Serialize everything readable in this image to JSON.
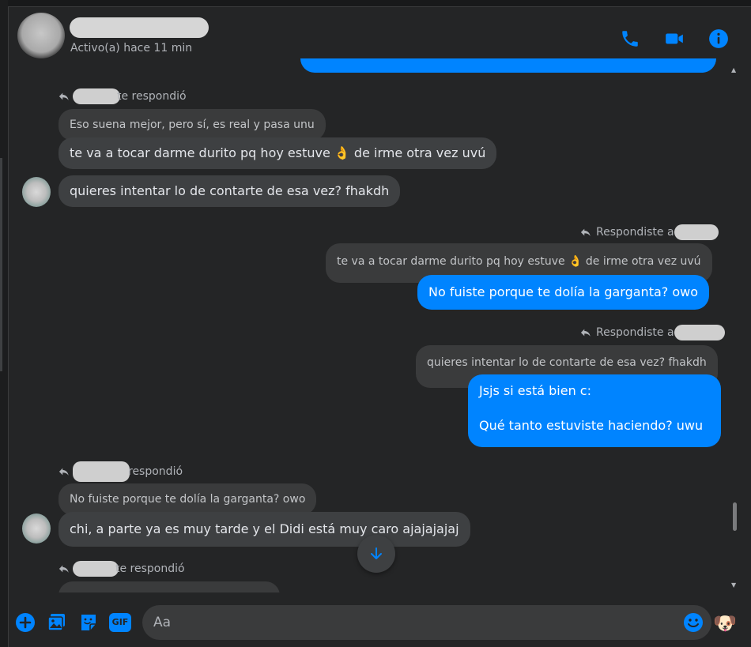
{
  "header": {
    "status": "Activo(a) hace 11 min",
    "icons": [
      "phone-icon",
      "video-icon",
      "info-icon"
    ]
  },
  "messages": {
    "m1_replied": "te respondió",
    "m1_quote": "Eso suena mejor, pero sí, es real y pasa unu",
    "m2": "te va a tocar darme durito pq hoy estuve 👌 de irme otra vez uvú",
    "m3": "quieres intentar lo de contarte de esa vez? fhakdh",
    "m4_replied": "Respondiste a",
    "m4_quote": "te va a tocar darme durito pq hoy estuve 👌 de irme otra vez uvú",
    "m4": "No fuiste porque te dolía la garganta? owo",
    "m5_replied": "Respondiste a",
    "m5_quote": "quieres intentar lo de contarte de esa vez? fhakdh",
    "m5_line1": "Jsjs si está bien c:",
    "m5_line2": "Qué tanto estuviste haciendo? uwu",
    "m6_replied": "respondió",
    "m6_quote": "No fuiste porque te dolía la garganta? owo",
    "m6": "chi, a parte ya es muy tarde y el Didi está muy caro ajajajajaj",
    "m7_replied": "te respondió"
  },
  "composer": {
    "placeholder": "Aa",
    "icons": [
      "plus-icon",
      "photo-icon",
      "sticker-icon",
      "gif-icon",
      "emoji-icon",
      "dog-reaction-icon"
    ],
    "gif_label": "GIF",
    "reaction": "🐶"
  },
  "colors": {
    "accent": "#0084ff",
    "incoming_bubble": "#3e4042",
    "background": "#242526"
  }
}
